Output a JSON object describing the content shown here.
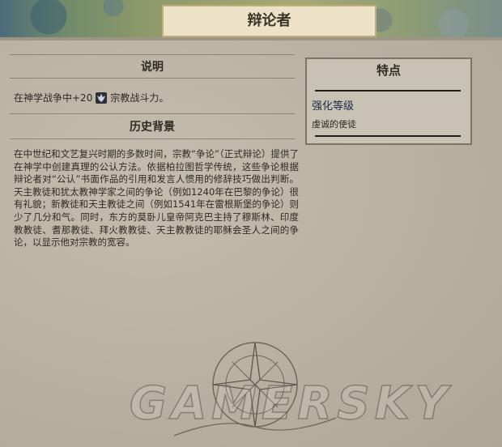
{
  "header": {
    "title": "辩论者"
  },
  "description": {
    "heading": "说明",
    "effect_prefix": "在神学战争中+20",
    "effect_icon": "religion-strength-icon",
    "effect_suffix": "宗教战斗力。"
  },
  "history": {
    "heading": "历史背景",
    "text": "在中世纪和文艺复兴时期的多数时间，宗教“争论”（正式辩论）提供了在神学中创建真理的公认方法。依据柏拉图哲学传统，这些争论根据辩论者对“公认”书面作品的引用和发言人惯用的修辞技巧做出判断。天主教徒和犹太教神学家之间的争论（例如1240年在巴黎的争论）很有礼貌；新教徒和天主教徒之间（例如1541年在雷根斯堡的争论）则少了几分和气。同时，东方的莫卧儿皇帝阿克巴主持了穆斯林、印度教教徒、耆那教徒、拜火教教徒、天主教教徒的耶稣会圣人之间的争论，以显示他对宗教的宽容。"
  },
  "traits": {
    "heading": "特点",
    "name": "强化等级",
    "desc": "虔诚的使徒"
  },
  "watermark": "GAMERSKY",
  "colors": {
    "title_tab": "#ece2c7",
    "panel_bg": "#c8c2b4",
    "trait_name": "#1f2a4a"
  }
}
